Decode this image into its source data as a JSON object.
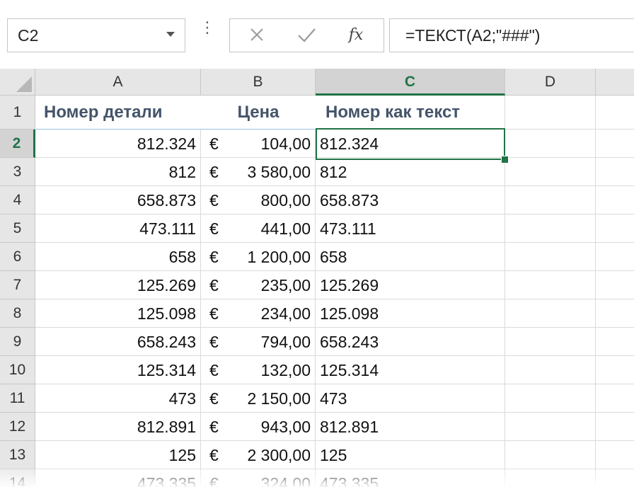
{
  "name_box": {
    "value": "C2"
  },
  "formula_bar": {
    "formula": "=ТЕКСТ(A2;\"###\")",
    "fx_label": "fx",
    "more_glyph": "⋮",
    "icons": [
      "cancel-icon",
      "enter-icon",
      "insert-function-icon",
      "chevron-down-icon"
    ]
  },
  "selected_cell": "C2",
  "accent_color": "#217346",
  "header_text_color": "#44546a",
  "columns": [
    {
      "label": "A"
    },
    {
      "label": "B"
    },
    {
      "label": "C"
    },
    {
      "label": "D"
    }
  ],
  "rows": [
    {
      "num": "1",
      "a": "Номер детали",
      "b_cur": "",
      "b": "Цена",
      "c": "Номер как текст"
    },
    {
      "num": "2",
      "a": "812.324",
      "b_cur": "€",
      "b": "104,00",
      "c": "812.324"
    },
    {
      "num": "3",
      "a": "812",
      "b_cur": "€",
      "b": "3 580,00",
      "c": "812"
    },
    {
      "num": "4",
      "a": "658.873",
      "b_cur": "€",
      "b": "800,00",
      "c": "658.873"
    },
    {
      "num": "5",
      "a": "473.111",
      "b_cur": "€",
      "b": "441,00",
      "c": "473.111"
    },
    {
      "num": "6",
      "a": "658",
      "b_cur": "€",
      "b": "1 200,00",
      "c": "658"
    },
    {
      "num": "7",
      "a": "125.269",
      "b_cur": "€",
      "b": "235,00",
      "c": "125.269"
    },
    {
      "num": "8",
      "a": "125.098",
      "b_cur": "€",
      "b": "234,00",
      "c": "125.098"
    },
    {
      "num": "9",
      "a": "658.243",
      "b_cur": "€",
      "b": "794,00",
      "c": "658.243"
    },
    {
      "num": "10",
      "a": "125.314",
      "b_cur": "€",
      "b": "132,00",
      "c": "125.314"
    },
    {
      "num": "11",
      "a": "473",
      "b_cur": "€",
      "b": "2 150,00",
      "c": "473"
    },
    {
      "num": "12",
      "a": "812.891",
      "b_cur": "€",
      "b": "943,00",
      "c": "812.891"
    },
    {
      "num": "13",
      "a": "125",
      "b_cur": "€",
      "b": "2 300,00",
      "c": "125"
    },
    {
      "num": "14",
      "a": "473.335",
      "b_cur": "€",
      "b": "324,00",
      "c": "473.335"
    }
  ]
}
